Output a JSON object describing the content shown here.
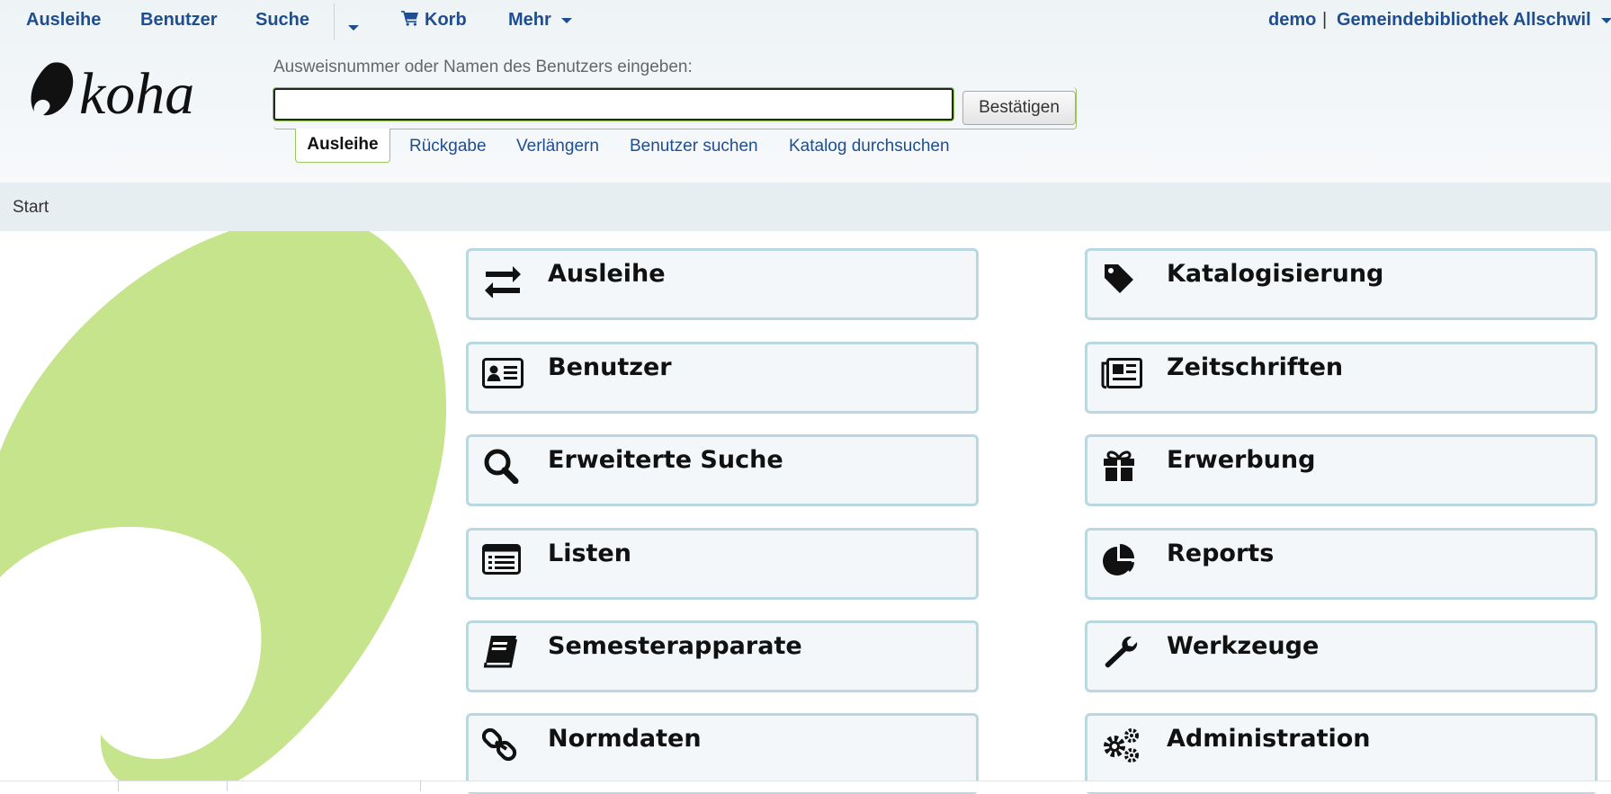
{
  "topnav": {
    "items": [
      {
        "label": "Ausleihe"
      },
      {
        "label": "Benutzer"
      },
      {
        "label": "Suche"
      },
      {
        "label": "Korb"
      },
      {
        "label": "Mehr"
      }
    ],
    "user": "demo",
    "separator": "|",
    "library": "Gemeindebibliothek Allschwil"
  },
  "search": {
    "label": "Ausweisnummer oder Namen des Benutzers eingeben:",
    "value": "",
    "submit_label": "Bestätigen",
    "tabs": [
      {
        "label": "Ausleihe",
        "active": true
      },
      {
        "label": "Rückgabe"
      },
      {
        "label": "Verlängern"
      },
      {
        "label": "Benutzer suchen"
      },
      {
        "label": "Katalog durchsuchen"
      }
    ]
  },
  "breadcrumb": {
    "label": "Start"
  },
  "modules": [
    {
      "label": "Ausleihe",
      "icon": "exchange-icon"
    },
    {
      "label": "Katalogisierung",
      "icon": "tag-icon"
    },
    {
      "label": "Benutzer",
      "icon": "id-card-icon"
    },
    {
      "label": "Zeitschriften",
      "icon": "newspaper-icon"
    },
    {
      "label": "Erweiterte Suche",
      "icon": "search-icon"
    },
    {
      "label": "Erwerbung",
      "icon": "gift-icon"
    },
    {
      "label": "Listen",
      "icon": "list-icon"
    },
    {
      "label": "Reports",
      "icon": "pie-chart-icon"
    },
    {
      "label": "Semesterapparate",
      "icon": "book-icon"
    },
    {
      "label": "Werkzeuge",
      "icon": "wrench-icon"
    },
    {
      "label": "Normdaten",
      "icon": "link-icon"
    },
    {
      "label": "Administration",
      "icon": "gears-icon"
    }
  ],
  "colors": {
    "link": "#1f4e8f",
    "tile_border": "#b9d8df",
    "tile_bg": "#f3f7f9",
    "leaf": "#c5e48b",
    "accent_green": "#9ac75a"
  }
}
